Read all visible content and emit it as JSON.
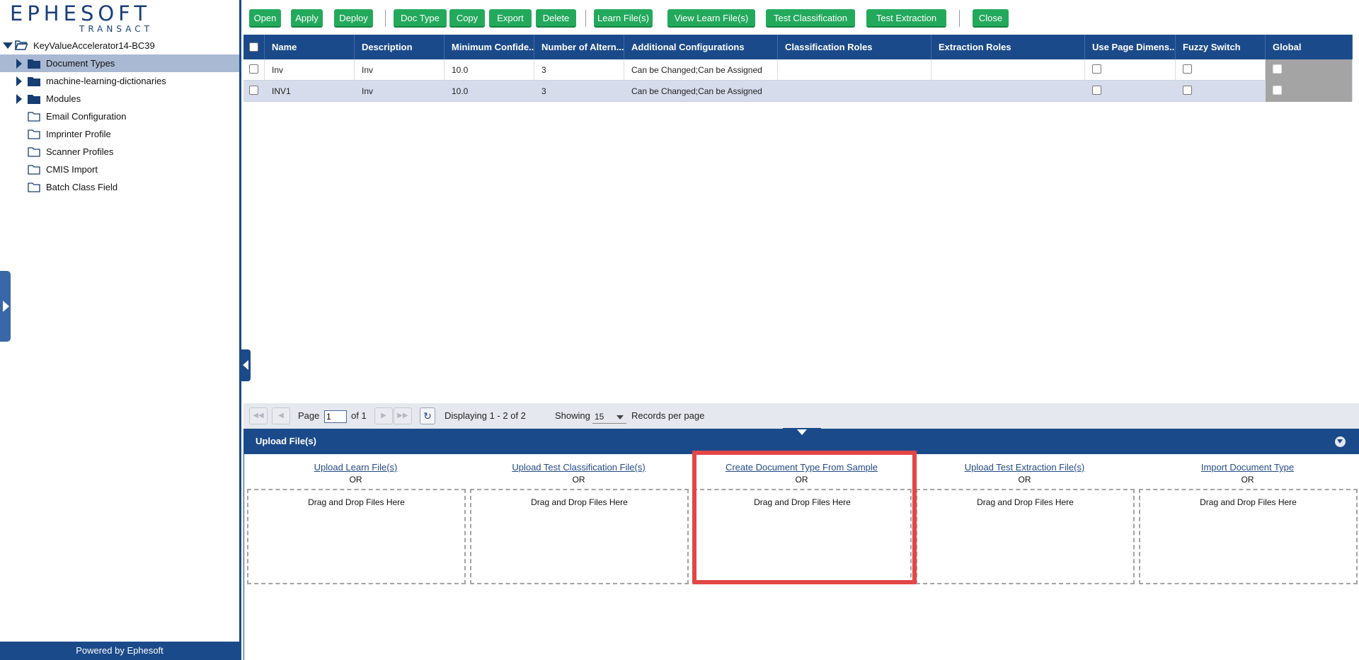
{
  "brand": {
    "logo_word": "EPHESOFT",
    "logo_sub": "TRANSACT",
    "footer": "Powered by Ephesoft"
  },
  "tree": {
    "root": "KeyValueAccelerator14-BC39",
    "items": [
      {
        "label": "Document Types",
        "expandable": true,
        "selected": true,
        "filled": true
      },
      {
        "label": "machine-learning-dictionaries",
        "expandable": true,
        "selected": false,
        "filled": true
      },
      {
        "label": "Modules",
        "expandable": true,
        "selected": false,
        "filled": true
      },
      {
        "label": "Email Configuration",
        "expandable": false,
        "selected": false,
        "filled": false
      },
      {
        "label": "Imprinter Profile",
        "expandable": false,
        "selected": false,
        "filled": false
      },
      {
        "label": "Scanner Profiles",
        "expandable": false,
        "selected": false,
        "filled": false
      },
      {
        "label": "CMIS Import",
        "expandable": false,
        "selected": false,
        "filled": false
      },
      {
        "label": "Batch Class Field",
        "expandable": false,
        "selected": false,
        "filled": false
      }
    ]
  },
  "toolbar": {
    "buttons": [
      "Open",
      "Apply",
      "Deploy",
      "Doc Type",
      "Copy",
      "Export",
      "Delete",
      "Learn File(s)",
      "View Learn File(s)",
      "Test Classification",
      "Test Extraction",
      "Close"
    ],
    "accent": "#23a95c"
  },
  "grid": {
    "columns": [
      "",
      "Name",
      "Description",
      "Minimum Confide...",
      "Number of Altern...",
      "Additional Configurations",
      "Classification Roles",
      "Extraction Roles",
      "Use Page Dimens...",
      "Fuzzy Switch",
      "Global"
    ],
    "rows": [
      {
        "name": "Inv",
        "description": "Inv",
        "min_confidence": "10.0",
        "alternatives": "3",
        "additional": "Can be Changed;Can be Assigned",
        "classification_roles": "",
        "extraction_roles": ""
      },
      {
        "name": "INV1",
        "description": "Inv",
        "min_confidence": "10.0",
        "alternatives": "3",
        "additional": "Can be Changed;Can be Assigned",
        "classification_roles": "",
        "extraction_roles": ""
      }
    ],
    "header_color": "#1b4a8a"
  },
  "pager": {
    "page_label": "Page",
    "page_value": "1",
    "of_label": "of 1",
    "displaying": "Displaying 1 - 2 of 2",
    "showing_label": "Showing",
    "records_value": "15",
    "records_label": "Records per page"
  },
  "upload": {
    "title": "Upload File(s)",
    "or": "OR",
    "drop_text": "Drag and Drop Files Here",
    "columns": [
      "Upload Learn File(s)",
      "Upload Test Classification File(s)",
      "Create Document Type From Sample",
      "Upload Test Extraction File(s)",
      "Import Document Type"
    ],
    "highlight_color": "#e24646"
  }
}
